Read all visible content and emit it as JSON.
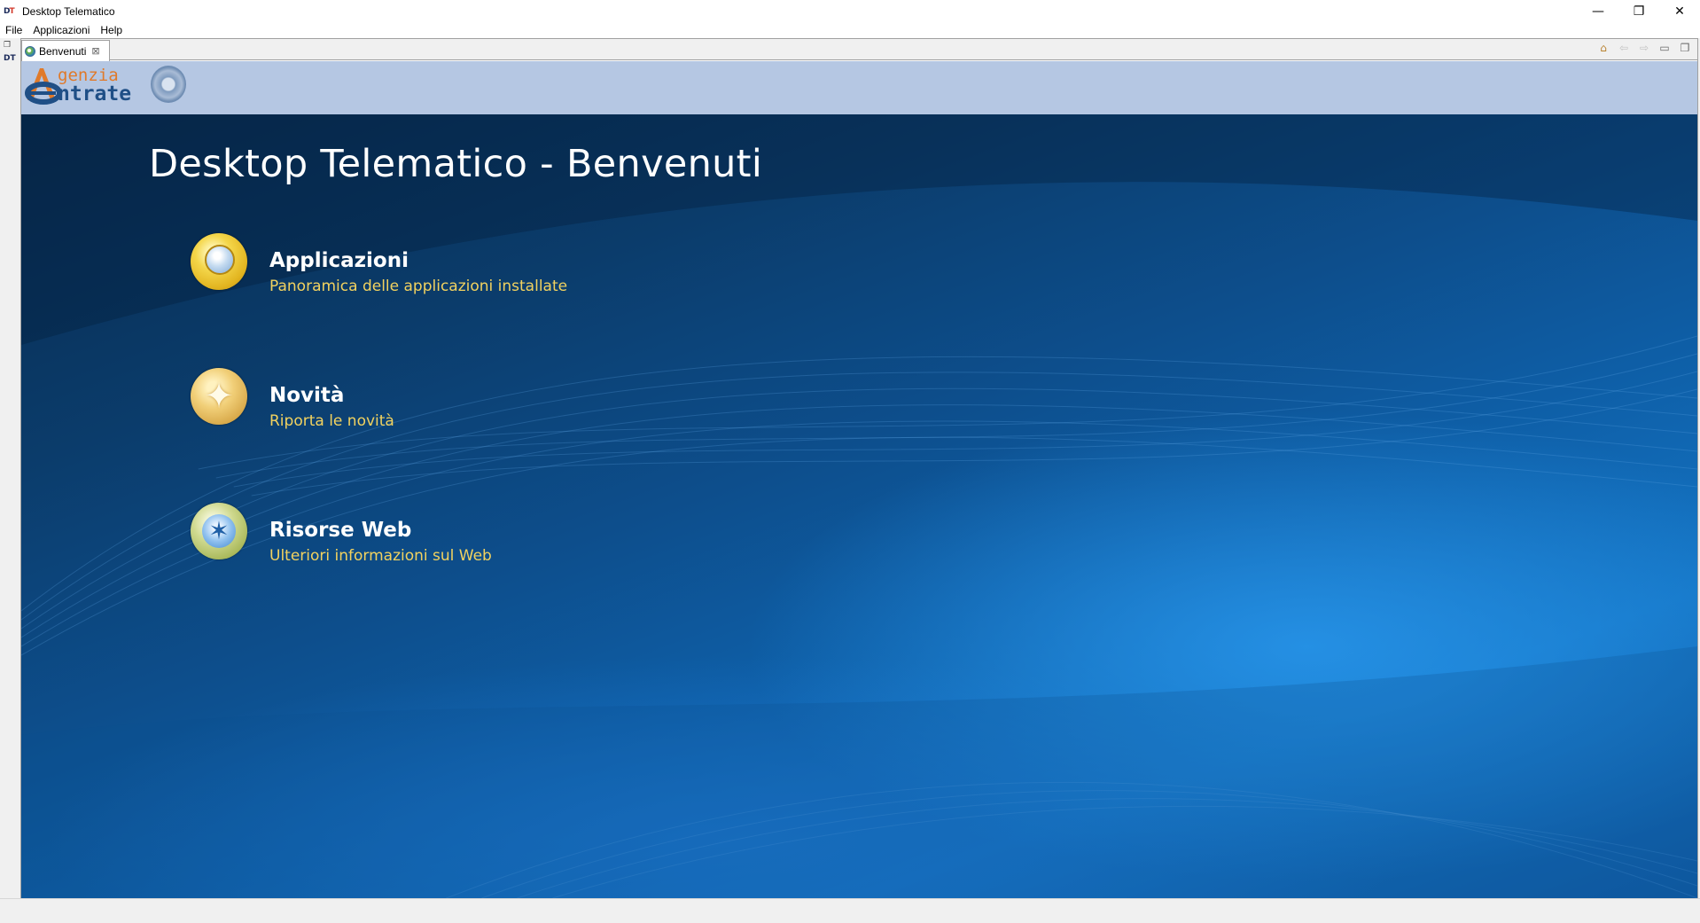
{
  "window": {
    "app_icon": "DT",
    "title": "Desktop Telematico",
    "controls": {
      "minimize": "—",
      "restore": "❐",
      "close": "✕"
    }
  },
  "menubar": {
    "items": [
      "File",
      "Applicazioni",
      "Help"
    ]
  },
  "editor": {
    "tab": {
      "label": "Benvenuti",
      "close": "⊠"
    },
    "view_tools": {
      "home": "⌂",
      "back": "⇦",
      "forward": "⇨",
      "minimize": "▭",
      "maximize": "❐"
    }
  },
  "header": {
    "logo": {
      "word1": "genzia",
      "word2": "ntrate"
    }
  },
  "welcome": {
    "title": "Desktop Telematico - Benvenuti",
    "links": [
      {
        "icon": "globe-icon",
        "title": "Applicazioni",
        "description": "Panoramica delle applicazioni installate"
      },
      {
        "icon": "star-icon",
        "title": "Novità",
        "description": "Riporta le novità"
      },
      {
        "icon": "web-icon",
        "title": "Risorse Web",
        "description": "Ulteriori informazioni sul Web"
      }
    ]
  },
  "colors": {
    "header_band": "#b5c7e3",
    "welcome_bg_dark": "#072a4e",
    "welcome_bg_light": "#1474c4",
    "link_title": "#ffffff",
    "link_description": "#f2d25f",
    "logo_orange": "#e07a2a",
    "logo_blue": "#1f4f86"
  }
}
